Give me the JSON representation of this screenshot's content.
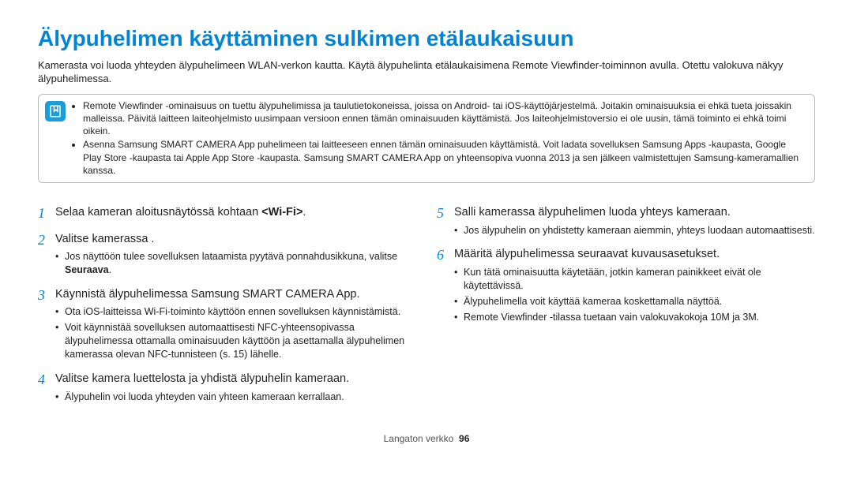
{
  "title": "Älypuhelimen käyttäminen sulkimen etälaukaisuun",
  "intro": "Kamerasta voi luoda yhteyden älypuhelimeen WLAN-verkon kautta. Käytä älypuhelinta etälaukaisimena Remote Viewfinder-toiminnon avulla. Otettu valokuva näkyy älypuhelimessa.",
  "note": {
    "items": [
      "Remote Viewfinder -ominaisuus on tuettu älypuhelimissa ja taulutietokoneissa, joissa on Android- tai iOS-käyttöjärjestelmä. Joitakin ominaisuuksia ei ehkä tueta joissakin malleissa. Päivitä laitteen laiteohjelmisto uusimpaan versioon ennen tämän ominaisuuden käyttämistä. Jos laiteohjelmistoversio ei ole uusin, tämä toiminto ei ehkä toimi oikein.",
      "Asenna Samsung SMART CAMERA App puhelimeen tai laitteeseen ennen tämän ominaisuuden käyttämistä. Voit ladata sovelluksen Samsung Apps -kaupasta, Google Play Store -kaupasta tai Apple App Store -kaupasta. Samsung SMART CAMERA App on yhteensopiva vuonna 2013 ja sen jälkeen valmistettujen Samsung-kameramallien kanssa."
    ]
  },
  "steps_left": [
    {
      "num": "1",
      "title_pre": "Selaa kameran aloitusnäytössä kohtaan ",
      "title_bold": "<Wi-Fi>",
      "title_post": ".",
      "bullets": []
    },
    {
      "num": "2",
      "title_pre": "Valitse kamerassa        .",
      "title_bold": "",
      "title_post": "",
      "bullets": [
        "Jos näyttöön tulee sovelluksen lataamista pyytävä ponnahdusikkuna, valitse "
      ],
      "bullet_bold": "Seuraava",
      "bullet_post": "."
    },
    {
      "num": "3",
      "title_pre": "Käynnistä älypuhelimessa Samsung SMART CAMERA App.",
      "title_bold": "",
      "title_post": "",
      "bullets": [
        "Ota iOS-laitteissa Wi-Fi-toiminto käyttöön ennen sovelluksen käynnistämistä.",
        "Voit käynnistää sovelluksen automaattisesti NFC-yhteensopivassa älypuhelimessa ottamalla ominaisuuden käyttöön ja asettamalla älypuhelimen kamerassa olevan NFC-tunnisteen (s. 15) lähelle."
      ]
    },
    {
      "num": "4",
      "title_pre": "Valitse kamera luettelosta ja yhdistä älypuhelin kameraan.",
      "title_bold": "",
      "title_post": "",
      "bullets": [
        "Älypuhelin voi luoda yhteyden vain yhteen kameraan kerrallaan."
      ]
    }
  ],
  "steps_right": [
    {
      "num": "5",
      "title_pre": "Salli kamerassa älypuhelimen luoda yhteys kameraan.",
      "title_bold": "",
      "title_post": "",
      "bullets": [
        "Jos älypuhelin on yhdistetty kameraan aiemmin, yhteys luodaan automaattisesti."
      ]
    },
    {
      "num": "6",
      "title_pre": "Määritä älypuhelimessa seuraavat kuvausasetukset.",
      "title_bold": "",
      "title_post": "",
      "bullets": [
        "Kun tätä ominaisuutta käytetään, jotkin kameran painikkeet eivät ole käytettävissä.",
        "Älypuhelimella voit käyttää kameraa koskettamalla näyttöä.",
        "Remote Viewfinder -tilassa tuetaan vain valokuvakokoja 10M ja 3M."
      ]
    }
  ],
  "footer": {
    "section": "Langaton verkko",
    "page": "96"
  }
}
